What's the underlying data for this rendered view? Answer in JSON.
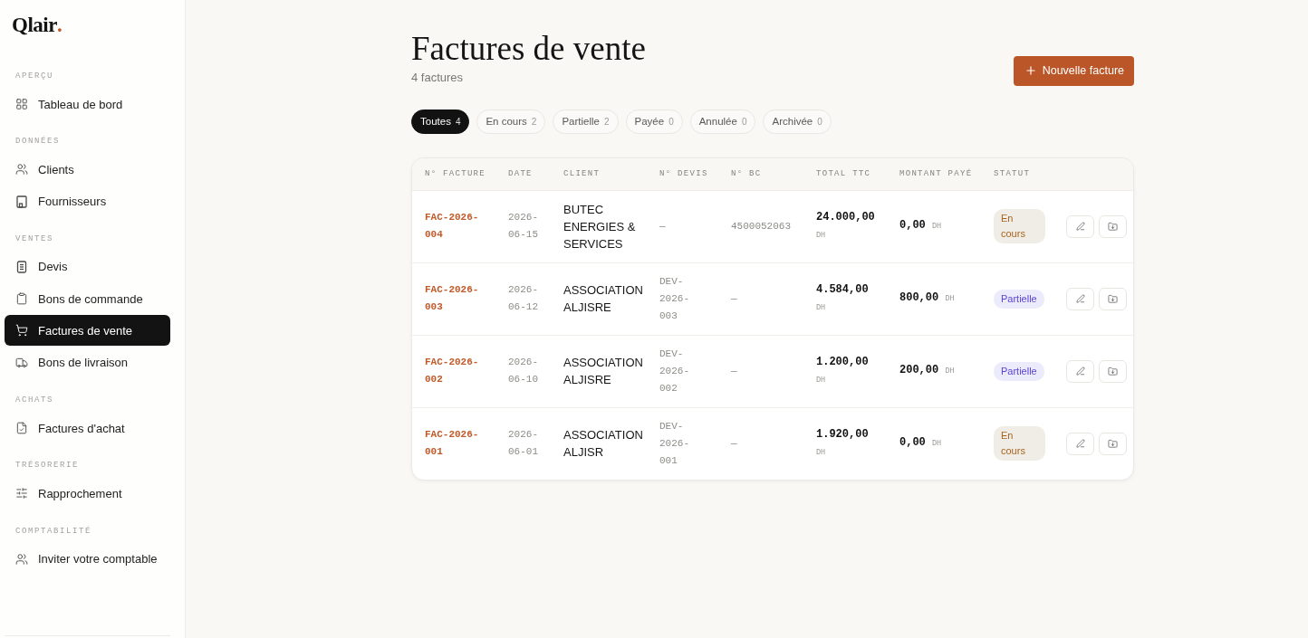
{
  "sidebar": {
    "logo": {
      "name": "Qlair",
      "mark": "."
    },
    "sections": [
      {
        "title": "APERÇU",
        "items": [
          {
            "label": "Tableau de bord",
            "selected": false
          }
        ]
      },
      {
        "title": "DONNÉES",
        "items": [
          {
            "label": "Clients",
            "selected": false
          },
          {
            "label": "Fournisseurs",
            "selected": false
          }
        ]
      },
      {
        "title": "VENTES",
        "items": [
          {
            "label": "Devis",
            "selected": false
          },
          {
            "label": "Bons de commande",
            "selected": false
          },
          {
            "label": "Factures de vente",
            "selected": true
          },
          {
            "label": "Bons de livraison",
            "selected": false
          }
        ]
      },
      {
        "title": "ACHATS",
        "items": [
          {
            "label": "Factures d'achat",
            "selected": false
          }
        ]
      },
      {
        "title": "TRÉSORERIE",
        "items": [
          {
            "label": "Rapprochement",
            "selected": false
          }
        ]
      },
      {
        "title": "COMPTABILITÉ",
        "items": [
          {
            "label": "Inviter votre comptable",
            "selected": false
          }
        ]
      }
    ]
  },
  "page": {
    "title": "Factures de vente",
    "subtitle": "4 factures",
    "new_button": "Nouvelle facture"
  },
  "tabs": [
    {
      "label": "Toutes",
      "count": "4",
      "selected": true
    },
    {
      "label": "En cours",
      "count": "2",
      "selected": false
    },
    {
      "label": "Partielle",
      "count": "2",
      "selected": false
    },
    {
      "label": "Payée",
      "count": "0",
      "selected": false
    },
    {
      "label": "Annulée",
      "count": "0",
      "selected": false
    },
    {
      "label": "Archivée",
      "count": "0",
      "selected": false
    }
  ],
  "table": {
    "columns": [
      "N° FACTURE",
      "DATE",
      "CLIENT",
      "N° DEVIS",
      "N° BC",
      "TOTAL TTC",
      "MONTANT PAYÉ",
      "STATUT"
    ],
    "rows": [
      {
        "invoice": "FAC-2026-004",
        "date": "2026-06-15",
        "client": "BUTEC ENERGIES & SERVICES",
        "quote": "—",
        "po": "4500052063",
        "total": "24.000,00",
        "total_currency": "DH",
        "paid": "0,00",
        "paid_currency": "DH",
        "status": {
          "label": "En cours",
          "kind": "pending"
        }
      },
      {
        "invoice": "FAC-2026-003",
        "date": "2026-06-12",
        "client": "ASSOCIATION ALJISRE",
        "quote": "DEV-2026-003",
        "po": "—",
        "total": "4.584,00",
        "total_currency": "DH",
        "paid": "800,00",
        "paid_currency": "DH",
        "status": {
          "label": "Partielle",
          "kind": "partial"
        }
      },
      {
        "invoice": "FAC-2026-002",
        "date": "2026-06-10",
        "client": "ASSOCIATION ALJISRE",
        "quote": "DEV-2026-002",
        "po": "—",
        "total": "1.200,00",
        "total_currency": "DH",
        "paid": "200,00",
        "paid_currency": "DH",
        "status": {
          "label": "Partielle",
          "kind": "partial"
        }
      },
      {
        "invoice": "FAC-2026-001",
        "date": "2026-06-01",
        "client": "ASSOCIATION ALJISR",
        "quote": "DEV-2026-001",
        "po": "—",
        "total": "1.920,00",
        "total_currency": "DH",
        "paid": "0,00",
        "paid_currency": "DH",
        "status": {
          "label": "En cours",
          "kind": "pending"
        }
      }
    ]
  }
}
